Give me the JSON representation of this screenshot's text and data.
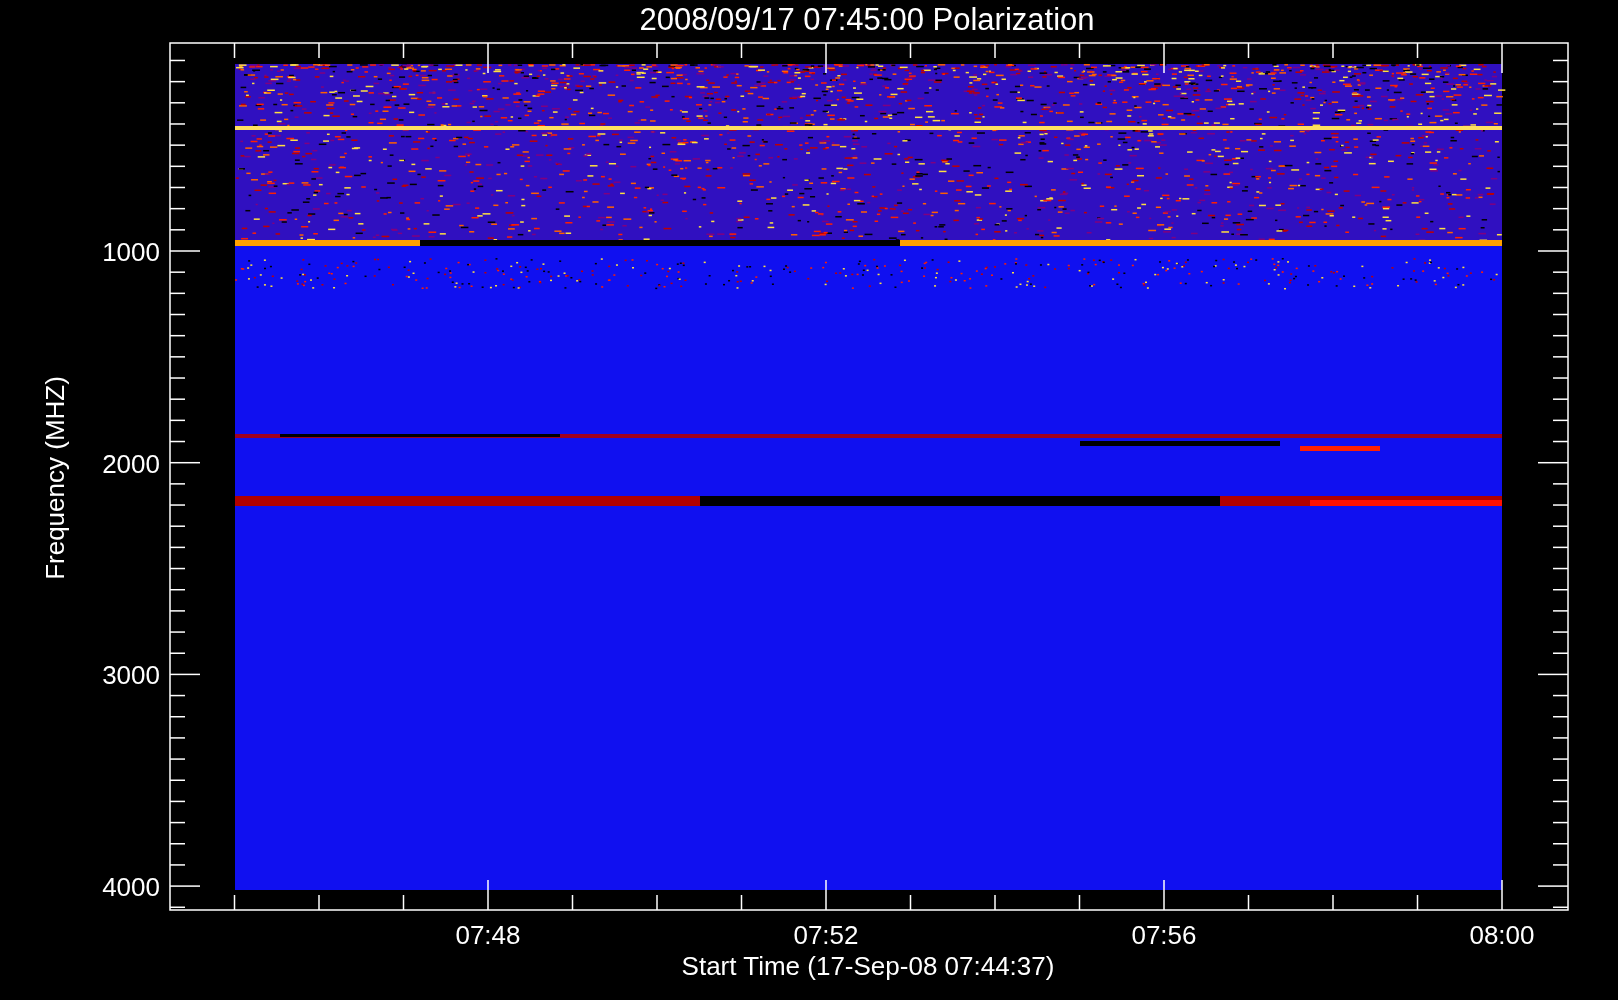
{
  "title": "2008/09/17 07:45:00 Polarization",
  "y_axis": {
    "label": "Frequency (MHZ)",
    "ticks": [
      "1000",
      "2000",
      "3000",
      "4000"
    ]
  },
  "x_axis": {
    "label": "Start Time (17-Sep-08 07:44:37)",
    "ticks": [
      "07:48",
      "07:52",
      "07:56",
      "08:00"
    ]
  }
}
